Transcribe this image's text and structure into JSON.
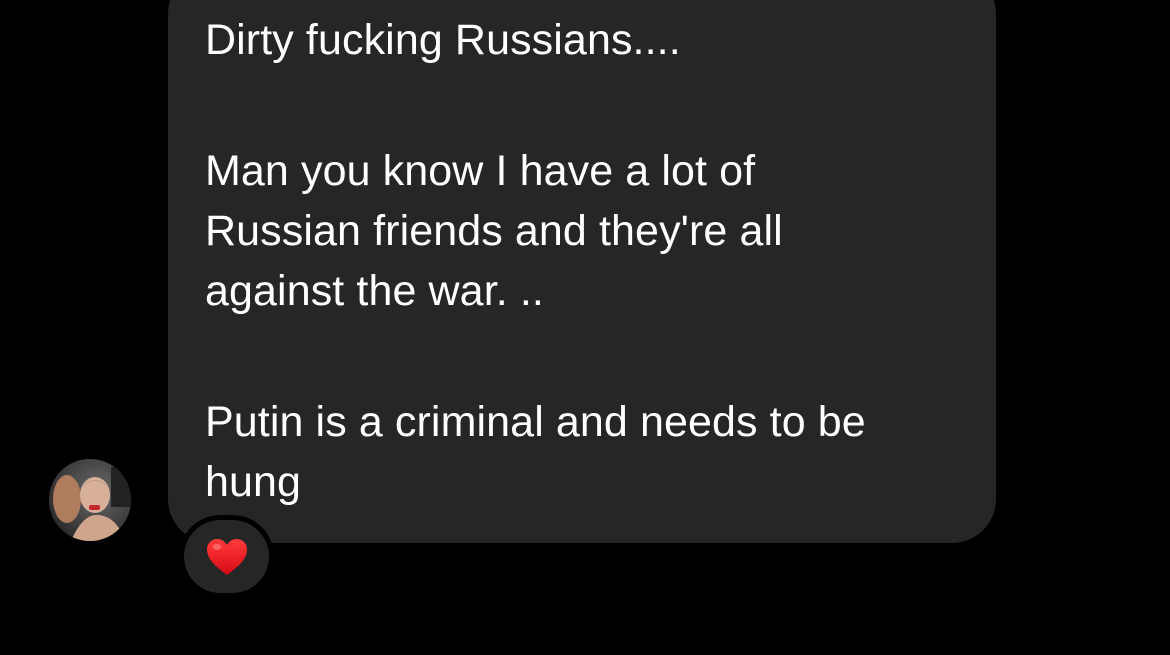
{
  "message": {
    "paragraphs": [
      "Dirty fucking Russians....",
      "Man you know I have a lot of\nRussian friends and they're all\nagainst the war. ..",
      "Putin is a criminal and needs to be\nhung"
    ],
    "reaction_icon": "red-heart-icon"
  },
  "colors": {
    "background": "#000000",
    "bubble": "#262626",
    "text": "#ffffff",
    "heart": "#e8121c"
  }
}
